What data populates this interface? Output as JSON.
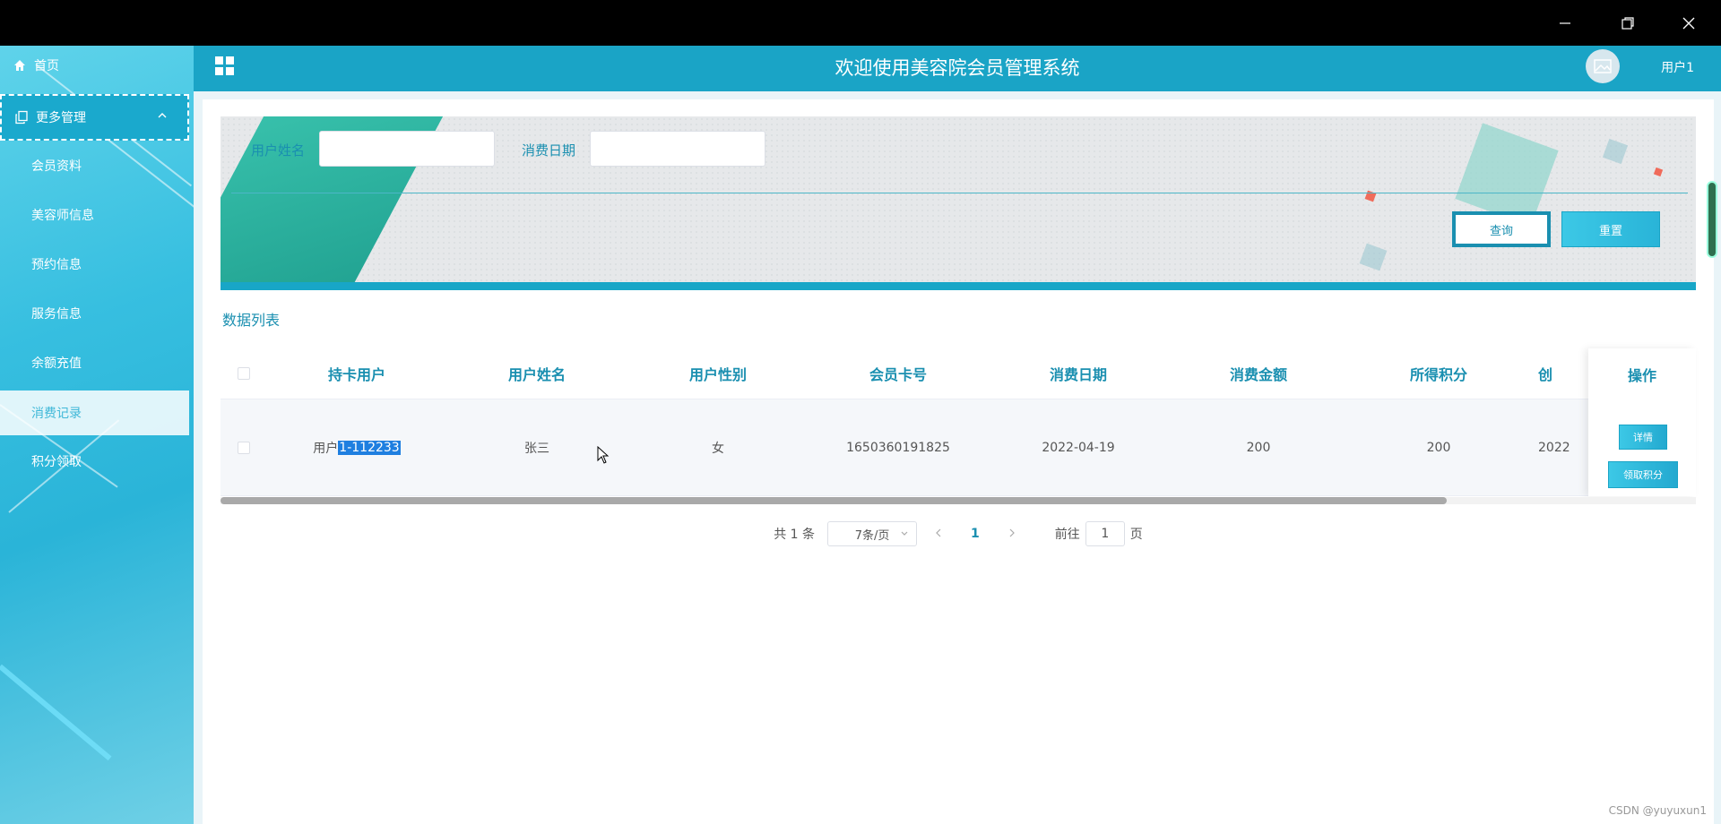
{
  "window": {
    "minimize_icon": "minimize-icon",
    "restore_icon": "restore-icon",
    "close_icon": "close-icon"
  },
  "sidebar": {
    "home": "首页",
    "group": "更多管理",
    "items": [
      {
        "label": "会员资料"
      },
      {
        "label": "美容师信息"
      },
      {
        "label": "预约信息"
      },
      {
        "label": "服务信息"
      },
      {
        "label": "余额充值"
      },
      {
        "label": "消费记录"
      },
      {
        "label": "积分领取"
      }
    ]
  },
  "header": {
    "title": "欢迎使用美容院会员管理系统",
    "username": "用户1"
  },
  "search": {
    "name_label": "用户姓名",
    "date_label": "消费日期",
    "query_button": "查询",
    "reset_button": "重置"
  },
  "table": {
    "section_title": "数据列表",
    "columns": [
      "持卡用户",
      "用户姓名",
      "用户性别",
      "会员卡号",
      "消费日期",
      "消费金额",
      "所得积分",
      "创"
    ],
    "ops_header": "操作",
    "rows": [
      {
        "card_user_prefix": "用户",
        "card_user_selected": "1-112233",
        "name": "张三",
        "gender": "女",
        "card_no": "1650360191825",
        "date": "2022-04-19",
        "amount": "200",
        "points": "200",
        "created": "2022"
      }
    ],
    "detail_button": "详情",
    "claim_button": "领取积分"
  },
  "pagination": {
    "total": "共 1 条",
    "page_size": "7条/页",
    "current_page": "1",
    "goto_prefix": "前往",
    "goto_value": "1",
    "goto_suffix": "页"
  },
  "watermark": "CSDN @yuyuxun1",
  "colors": {
    "accent": "#1aa4c6",
    "text_accent": "#1a8fb0",
    "selection": "#1f7fe0"
  }
}
